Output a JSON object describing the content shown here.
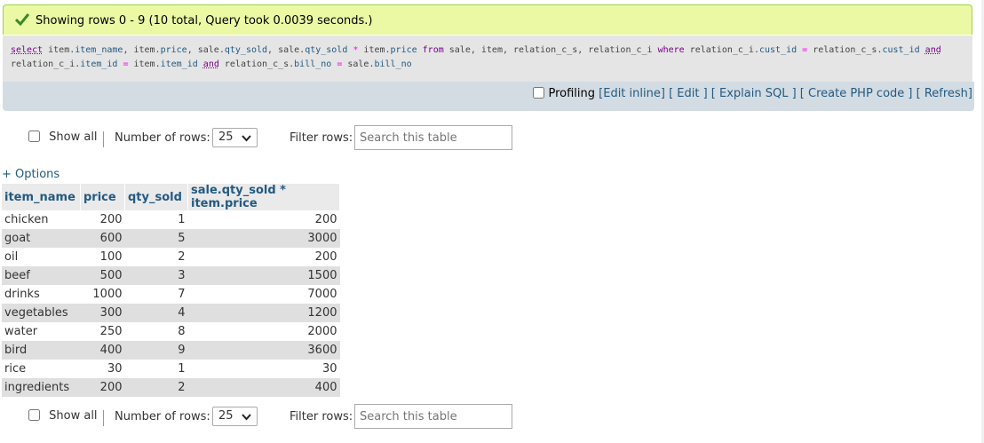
{
  "success_message": "Showing rows 0 - 9 (10 total, Query took 0.0039 seconds.)",
  "sql": {
    "line1": [
      {
        "t": "select",
        "c": "kw"
      },
      {
        "t": " item.",
        "c": ""
      },
      {
        "t": "item_name",
        "c": "col"
      },
      {
        "t": ", item.",
        "c": ""
      },
      {
        "t": "price",
        "c": "col"
      },
      {
        "t": ", sale.",
        "c": ""
      },
      {
        "t": "qty_sold",
        "c": "col"
      },
      {
        "t": ", sale.",
        "c": ""
      },
      {
        "t": "qty_sold",
        "c": "col"
      },
      {
        "t": " * ",
        "c": "op"
      },
      {
        "t": "item.",
        "c": ""
      },
      {
        "t": "price",
        "c": "col"
      },
      {
        "t": " from ",
        "c": "kw2"
      },
      {
        "t": "sale, item, relation_c_s, relation_c_i ",
        "c": ""
      },
      {
        "t": "where",
        "c": "kw2"
      },
      {
        "t": " relation_c_i.",
        "c": ""
      },
      {
        "t": "cust_id",
        "c": "col"
      },
      {
        "t": " = ",
        "c": "op"
      },
      {
        "t": "relation_c_s.",
        "c": ""
      },
      {
        "t": "cust_id",
        "c": "col"
      },
      {
        "t": " ",
        "c": ""
      },
      {
        "t": "and",
        "c": "kw"
      }
    ],
    "line2": [
      {
        "t": "relation_c_i.",
        "c": ""
      },
      {
        "t": "item_id",
        "c": "col"
      },
      {
        "t": " = ",
        "c": "op"
      },
      {
        "t": "item.",
        "c": ""
      },
      {
        "t": "item_id",
        "c": "col"
      },
      {
        "t": " ",
        "c": ""
      },
      {
        "t": "and",
        "c": "kw"
      },
      {
        "t": " relation_c_s.",
        "c": ""
      },
      {
        "t": "bill_no",
        "c": "col"
      },
      {
        "t": " = ",
        "c": "op"
      },
      {
        "t": "sale.",
        "c": ""
      },
      {
        "t": "bill_no",
        "c": "col"
      }
    ]
  },
  "tools": {
    "profiling": "Profiling",
    "edit_inline": "[Edit inline]",
    "edit": "[ Edit ]",
    "explain": "[ Explain SQL ]",
    "create_php": "[ Create PHP code ]",
    "refresh": "[ Refresh]"
  },
  "nav": {
    "show_all": "Show all",
    "num_rows_label": "Number of rows:",
    "num_rows_value": "25",
    "filter_label": "Filter rows:",
    "filter_placeholder": "Search this table"
  },
  "options_link": "+ Options",
  "table": {
    "headers": [
      "item_name",
      "price",
      "qty_sold",
      "sale.qty_sold * item.price"
    ],
    "rows": [
      [
        "chicken",
        "200",
        "1",
        "200"
      ],
      [
        "goat",
        "600",
        "5",
        "3000"
      ],
      [
        "oil",
        "100",
        "2",
        "200"
      ],
      [
        "beef",
        "500",
        "3",
        "1500"
      ],
      [
        "drinks",
        "1000",
        "7",
        "7000"
      ],
      [
        "vegetables",
        "300",
        "4",
        "1200"
      ],
      [
        "water",
        "250",
        "8",
        "2000"
      ],
      [
        "bird",
        "400",
        "9",
        "3600"
      ],
      [
        "rice",
        "30",
        "1",
        "30"
      ],
      [
        "ingredients",
        "200",
        "2",
        "400"
      ]
    ]
  },
  "icons": {
    "check": "check-icon",
    "chevron": "chevron-down-icon"
  },
  "colors": {
    "success_bg": "#ebf8a4",
    "link": "#235a81",
    "row_alt": "#dfdfdf"
  }
}
